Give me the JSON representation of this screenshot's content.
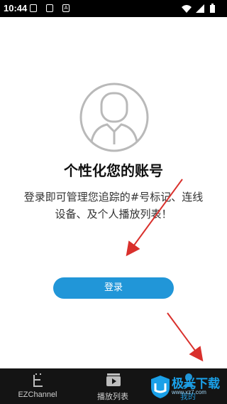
{
  "status_bar": {
    "time": "10:44",
    "icons": [
      "notification-icon",
      "notification-icon",
      "a-icon"
    ],
    "right_icons": [
      "wifi-icon",
      "signal-icon",
      "battery-icon"
    ]
  },
  "profile": {
    "headline": "个性化您的账号",
    "description": "登录即可管理您追踪的#号标记、连线设备、及个人播放列表！",
    "login_label": "登录",
    "avatar_icon": "user-avatar-icon"
  },
  "bottom_nav": {
    "items": [
      {
        "label": "EZChannel",
        "icon": "ezchannel-icon"
      },
      {
        "label": "播放列表",
        "icon": "playlist-icon"
      },
      {
        "label": "我的",
        "icon": "profile-icon"
      }
    ]
  },
  "watermark": {
    "text": "极光下载",
    "url": "www.xz7.com"
  },
  "colors": {
    "accent": "#2196D8",
    "nav_background": "#141414",
    "annotation_arrow": "#d9302c"
  }
}
